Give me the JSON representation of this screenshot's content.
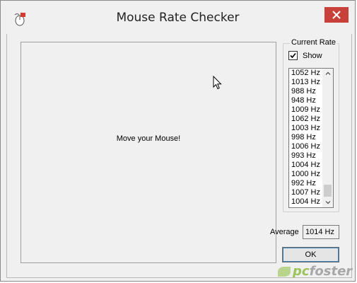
{
  "window": {
    "title": "Mouse Rate Checker",
    "icons": {
      "app": "mouse-app-icon",
      "close": "close-icon"
    },
    "accent_close": "#c9403a"
  },
  "main": {
    "instruction": "Move your Mouse!"
  },
  "current_rate": {
    "group_label": "Current Rate",
    "show_label": "Show",
    "show_checked": true,
    "rates": [
      "1052 Hz",
      "1013 Hz",
      "988 Hz",
      "948 Hz",
      "1009 Hz",
      "1062 Hz",
      "1003 Hz",
      "998 Hz",
      "1006 Hz",
      "993 Hz",
      "1004 Hz",
      "1000 Hz",
      "992 Hz",
      "1007 Hz",
      "1004 Hz"
    ]
  },
  "average": {
    "label": "Average",
    "value": "1014 Hz"
  },
  "buttons": {
    "ok_label": "OK"
  },
  "watermark": {
    "part1": "pc",
    "part2": "foster"
  }
}
